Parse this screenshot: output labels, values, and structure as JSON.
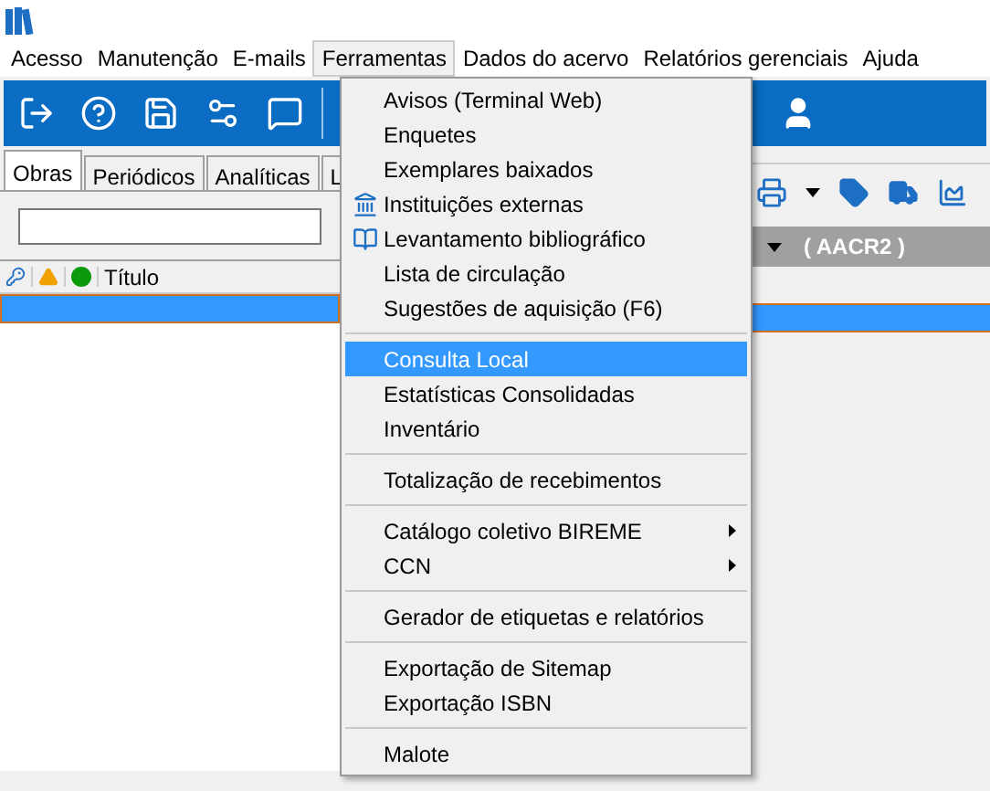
{
  "menubar": [
    {
      "label": "Acesso",
      "selected": false
    },
    {
      "label": "Manutenção",
      "selected": false
    },
    {
      "label": "E-mails",
      "selected": false
    },
    {
      "label": "Ferramentas",
      "selected": true
    },
    {
      "label": "Dados do acervo",
      "selected": false
    },
    {
      "label": "Relatórios gerenciais",
      "selected": false
    },
    {
      "label": "Ajuda",
      "selected": false
    }
  ],
  "tabs": [
    {
      "label": "Obras",
      "selected": true
    },
    {
      "label": "Periódicos",
      "selected": false
    },
    {
      "label": "Analíticas",
      "selected": false
    },
    {
      "label": "L",
      "selected": false
    }
  ],
  "grid": {
    "columns": [
      "Título"
    ],
    "rows": [
      {
        "selected": true
      }
    ]
  },
  "right_panel": {
    "header": "( AACR2 )"
  },
  "menu": [
    {
      "kind": "item",
      "label": "Avisos (Terminal Web)",
      "selected": false
    },
    {
      "kind": "item",
      "label": "Enquetes",
      "selected": false
    },
    {
      "kind": "item",
      "label": "Exemplares baixados",
      "selected": false
    },
    {
      "kind": "icon-item",
      "label": "Instituições externas",
      "selected": false
    },
    {
      "kind": "icon-item",
      "label": "Levantamento bibliográfico",
      "selected": false
    },
    {
      "kind": "item",
      "label": "Lista de circulação",
      "selected": false
    },
    {
      "kind": "item",
      "label": "Sugestões de aquisição (F6)",
      "selected": false
    },
    {
      "kind": "separator"
    },
    {
      "kind": "item",
      "label": "Consulta Local",
      "selected": true
    },
    {
      "kind": "item",
      "label": "Estatísticas Consolidadas",
      "selected": false
    },
    {
      "kind": "item",
      "label": "Inventário",
      "selected": false
    },
    {
      "kind": "separator"
    },
    {
      "kind": "item",
      "label": "Totalização de recebimentos",
      "selected": false
    },
    {
      "kind": "separator"
    },
    {
      "kind": "submenu",
      "label": "Catálogo coletivo BIREME",
      "selected": false
    },
    {
      "kind": "submenu",
      "label": "CCN",
      "selected": false
    },
    {
      "kind": "separator"
    },
    {
      "kind": "item",
      "label": "Gerador de etiquetas e relatórios",
      "selected": false
    },
    {
      "kind": "separator"
    },
    {
      "kind": "item",
      "label": "Exportação de Sitemap",
      "selected": false
    },
    {
      "kind": "item",
      "label": "Exportação ISBN",
      "selected": false
    },
    {
      "kind": "separator"
    },
    {
      "kind": "item",
      "label": "Malote",
      "selected": false
    }
  ]
}
